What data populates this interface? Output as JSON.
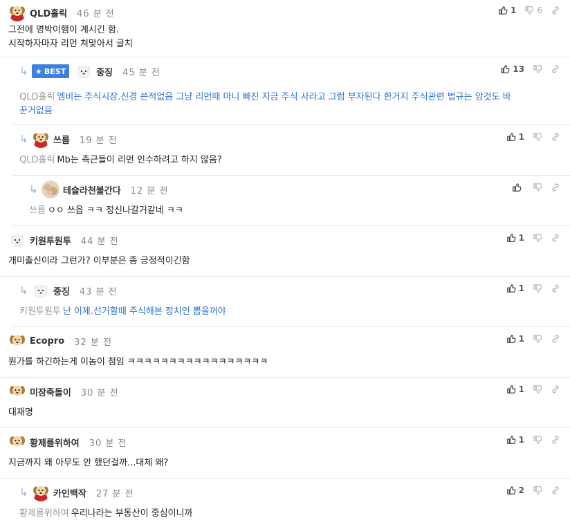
{
  "comments": [
    {
      "author": "QLD홀릭",
      "time": "46 분 전",
      "lines": [
        "그전에 명박이햄이 계시긴 함.",
        "시작하자마자 리먼 쳐맞아서 글치"
      ],
      "likes": "1",
      "dislikes": "6"
    },
    {
      "best_label": "BEST",
      "author": "중징",
      "time": "45 분 전",
      "mention": "QLD홀릭",
      "text_line1": "엠비는 주식시장.신경 쓴적없음 그냥 리먼때 마니 빠진 지금 주식 사라고 그럼 부자된다 한거지 주식관련 법규는 암것도 바",
      "text_line2": "꾼거없음",
      "likes": "13"
    },
    {
      "author": "쓰름",
      "time": "19 분 전",
      "mention": "QLD홀릭",
      "text": "Mb는 측근들이 리먼 인수하려고 하지 않음?",
      "likes": "1"
    },
    {
      "author": "테슬라천불간다",
      "time": "12 분 전",
      "mention": "쓰름",
      "text": "ㅇㅇ 쓰읍 ㅋㅋ 정신나갈거같네 ㅋㅋ",
      "likes": ""
    },
    {
      "author": "키원투원투",
      "time": "44 분 전",
      "text": "개미출신이라 그런가? 이부분은 좀 긍정적이긴함",
      "likes": "1"
    },
    {
      "author": "중징",
      "time": "43 분 전",
      "mention": "키원투원투",
      "text": "난 이제.선거할때 주식해본 정치인 뽑을꺼야",
      "likes": "1"
    },
    {
      "author": "Ecopro",
      "time": "32 분 전",
      "text": "뭔가를 하긴하는게 이놈이 첨임 ㅋㅋㅋㅋㅋㅋㅋㅋㅋㅋㅋㅋㅋㅋㅋㅋㅋ",
      "likes": "1"
    },
    {
      "author": "미장죽돌이",
      "time": "30 분 전",
      "text": "대재명",
      "likes": "1"
    },
    {
      "author": "황제를위하여",
      "time": "30 분 전",
      "text": "지금까지 왜 아무도 안 했던걸까...대체 왜?",
      "likes": "1"
    },
    {
      "author": "카인백작",
      "time": "27 분 전",
      "mention": "황제를위하여",
      "text": "우리나라는 부동산이 중심이니까",
      "likes": "2"
    }
  ],
  "icons": {
    "like": "thumbs-up-icon",
    "dislike": "thumbs-down-icon",
    "link": "link-icon",
    "reply": "reply-arrow-icon",
    "best_star": "star-icon"
  },
  "colors": {
    "best_badge": "#3f7fe0",
    "best_text": "#2a6fd6",
    "mention": "#9a9a9a",
    "divider": "#e6e6e6"
  }
}
